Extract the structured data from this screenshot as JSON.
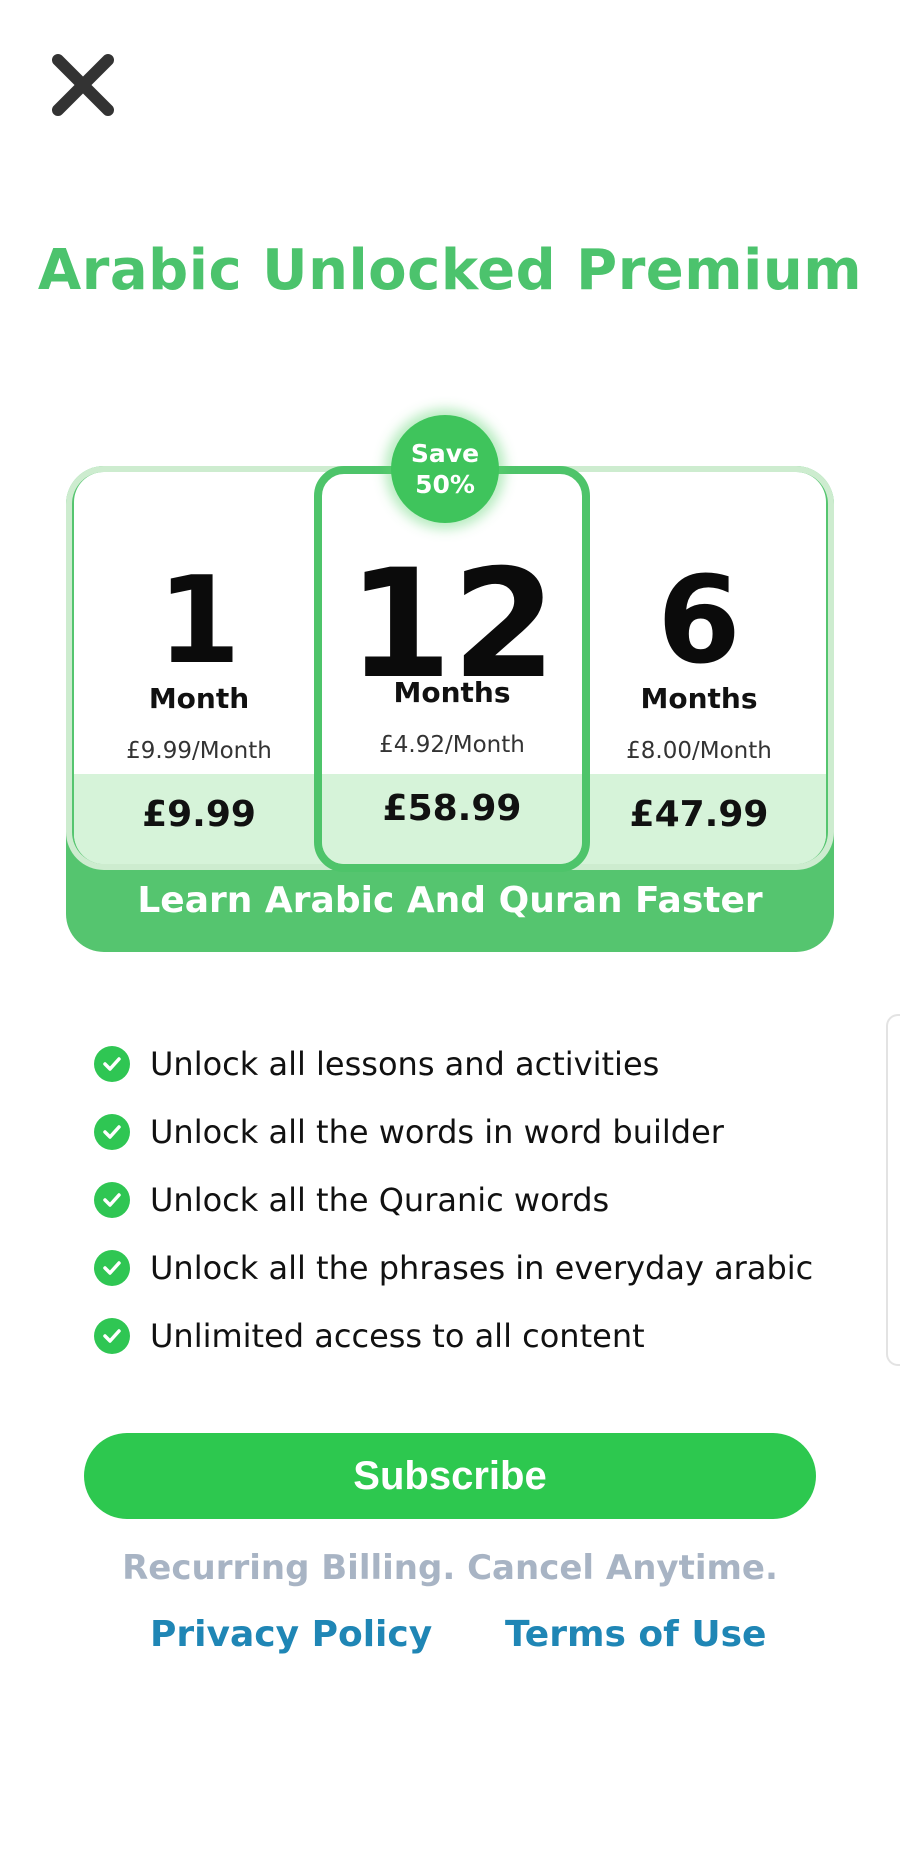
{
  "header": {
    "close_icon": "close-icon"
  },
  "title": "Arabic Unlocked Premium",
  "badge": {
    "line1": "Save",
    "line2": "50%"
  },
  "plans": [
    {
      "number": "1",
      "unit": "Month",
      "per_month": "£9.99/Month",
      "total": "£9.99"
    },
    {
      "number": "12",
      "unit": "Months",
      "per_month": "£4.92/Month",
      "total": "£58.99",
      "selected": true
    },
    {
      "number": "6",
      "unit": "Months",
      "per_month": "£8.00/Month",
      "total": "£47.99"
    }
  ],
  "tagline": "Learn Arabic And Quran Faster",
  "features": [
    "Unlock all lessons and activities",
    "Unlock all the words in word builder",
    "Unlock all the Quranic words",
    "Unlock all the phrases in everyday arabic",
    "Unlimited access to all content"
  ],
  "subscribe_label": "Subscribe",
  "billing_note": "Recurring Billing. Cancel Anytime.",
  "links": {
    "privacy": "Privacy Policy",
    "terms": "Terms of Use"
  },
  "colors": {
    "brand_green": "#4cc36d",
    "button_green": "#2dc84f",
    "link_blue": "#1f86b5",
    "muted": "#a8b4c4"
  }
}
